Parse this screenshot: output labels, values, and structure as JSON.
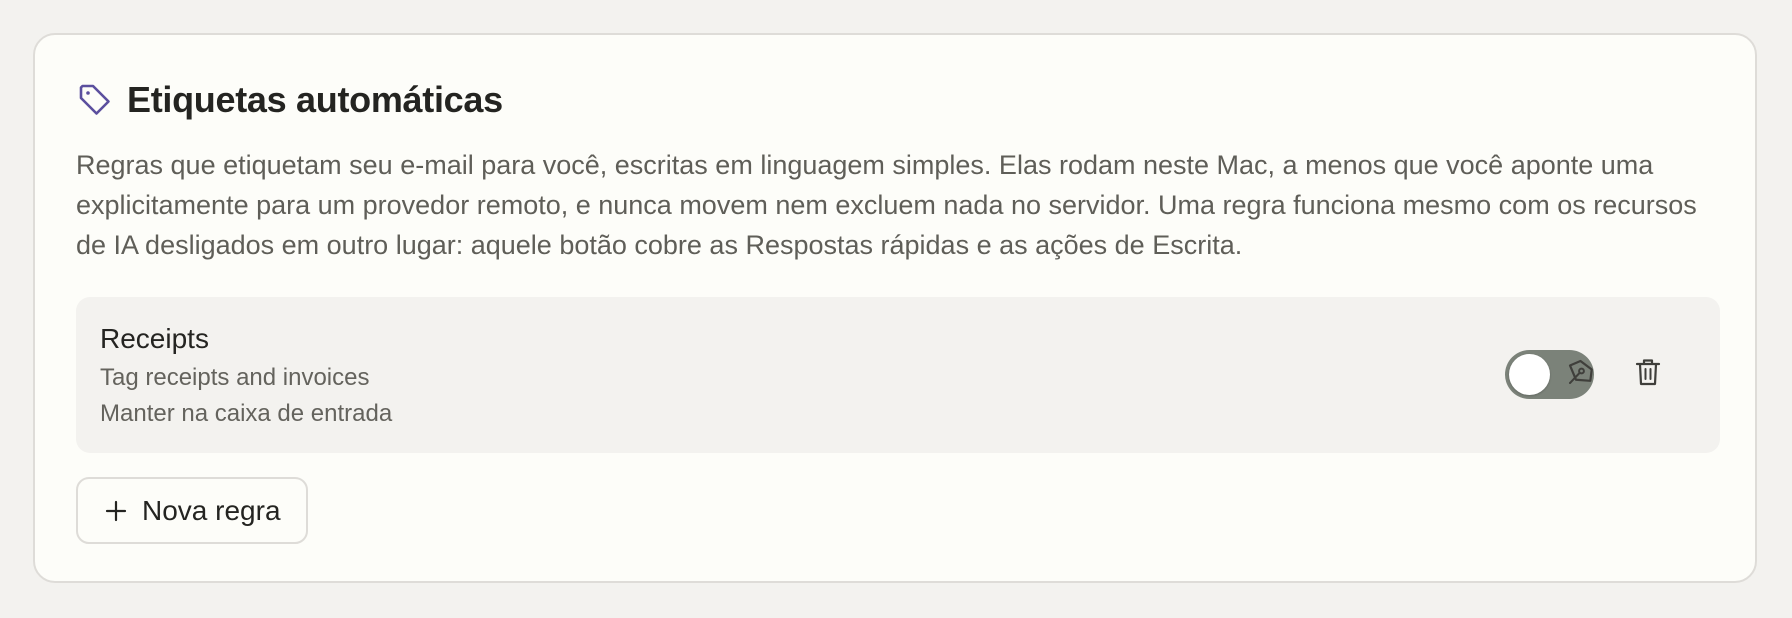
{
  "section": {
    "title": "Etiquetas automáticas",
    "icon": "tag-icon",
    "accent_color": "#5b4f9e",
    "description": "Regras que etiquetam seu e-mail para você, escritas em linguagem simples. Elas rodam neste Mac, a menos que você aponte uma explicitamente para um provedor remoto, e nunca movem nem excluem nada no servidor. Uma regra funciona mesmo com os recursos de IA desligados em outro lugar: aquele botão cobre as Respostas rápidas e as ações de Escrita."
  },
  "rules": [
    {
      "name": "Receipts",
      "description": "Tag receipts and invoices",
      "action": "Manter na caixa de entrada",
      "enabled": false,
      "edit_icon": "pen-icon",
      "delete_icon": "trash-icon"
    }
  ],
  "new_rule_button": {
    "label": "Nova regra",
    "icon": "plus-icon"
  }
}
